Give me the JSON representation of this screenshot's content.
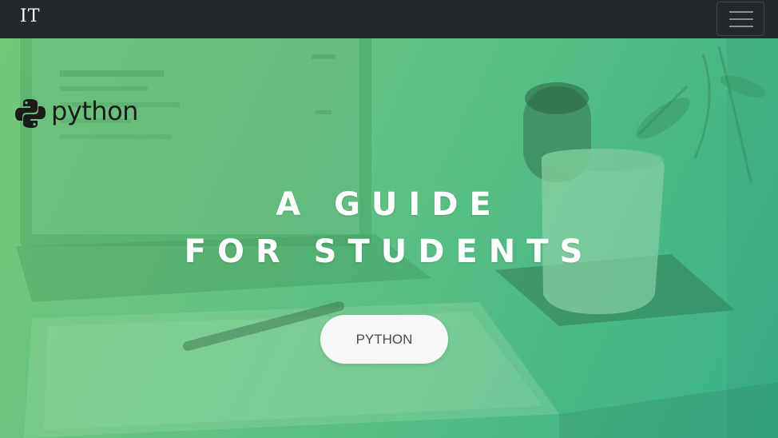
{
  "navbar": {
    "brand": "IT",
    "menu_icon": "hamburger-menu-icon"
  },
  "hero": {
    "logo_icon": "python-logo-icon",
    "logo_text": "python",
    "title_line_1": "A GUIDE",
    "title_line_2": "FOR STUDENTS",
    "cta_label": "PYTHON"
  },
  "colors": {
    "navbar_bg": "#24272c",
    "hero_gradient_start": "#73c77a",
    "hero_gradient_end": "#3fb488",
    "button_bg": "#f8f8f8"
  }
}
